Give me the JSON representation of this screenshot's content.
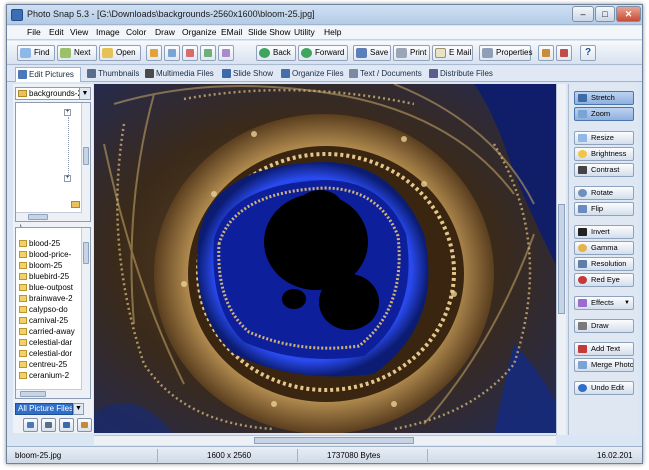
{
  "window": {
    "title": "Photo Snap 5.3 - [G:\\Downloads\\backgrounds-2560x1600\\bloom-25.jpg]",
    "controls": {
      "minimize": "–",
      "maximize": "□",
      "close": "✕"
    }
  },
  "menu": [
    "File",
    "Edit",
    "View",
    "Image",
    "Color",
    "Draw",
    "Organize",
    "EMail",
    "Slide Show",
    "Utility",
    "Help"
  ],
  "toolbar": {
    "find": "Find",
    "next": "Next",
    "open": "Open",
    "back": "Back",
    "forward": "Forward",
    "save": "Save",
    "print": "Print",
    "email": "E Mail",
    "properties": "Properties",
    "help": "?"
  },
  "tabs": [
    "Edit Pictures",
    "Thumbnails",
    "Multimedia Files",
    "Slide Show",
    "Organize Files",
    "Text / Documents",
    "Distribute Files"
  ],
  "folder": {
    "selected": "backgrounds-2560x1600"
  },
  "path_label": "..\\",
  "files": [
    "blood-25",
    "blood-price-",
    "bloom-25",
    "bluebird-25",
    "blue-outpost",
    "brainwave-2",
    "calypso-do",
    "carnival-25",
    "carried-away",
    "celestial-dar",
    "celestial-dor",
    "centreu-25",
    "ceranium-2"
  ],
  "filter": {
    "selected": "All Picture Files"
  },
  "tools": [
    "Stretch",
    "Zoom",
    "Resize",
    "Brightness",
    "Contrast",
    "Rotate",
    "Flip",
    "Invert",
    "Gamma",
    "Resolution",
    "Red Eye",
    "Effects",
    "Draw",
    "Add Text",
    "Merge Photos",
    "Undo Edit"
  ],
  "status": {
    "filename": "bloom-25.jpg",
    "dimensions": "1600 x 2560",
    "size": "1737080 Bytes",
    "date": "16.02.201"
  },
  "colors": {
    "accent": "#2f6fc9",
    "chrome": "#dbe6f4",
    "fractal_blue": "#1f3dd6",
    "fractal_gold": "#d9b774"
  }
}
